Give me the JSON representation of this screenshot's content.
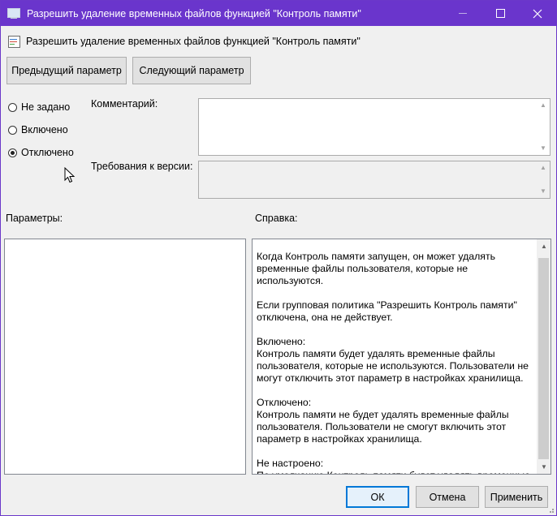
{
  "window": {
    "title": "Разрешить удаление временных файлов функцией \"Контроль памяти\"",
    "accent": "#6a35cc"
  },
  "header": {
    "policy_title": "Разрешить удаление временных файлов функцией \"Контроль памяти\""
  },
  "nav": {
    "prev_label": "Предыдущий параметр",
    "next_label": "Следующий параметр"
  },
  "state": {
    "options": [
      {
        "label": "Не задано",
        "checked": false
      },
      {
        "label": "Включено",
        "checked": false
      },
      {
        "label": "Отключено",
        "checked": true
      }
    ]
  },
  "fields": {
    "comment_label": "Комментарий:",
    "comment_value": "",
    "version_label": "Требования к версии:",
    "version_value": ""
  },
  "sections": {
    "params_label": "Параметры:",
    "help_label": "Справка:"
  },
  "help": {
    "paragraphs": [
      "Когда Контроль памяти запущен, он может удалять временные файлы пользователя, которые не используются.",
      "Если групповая политика \"Разрешить Контроль памяти\" отключена, она не действует.",
      "Включено:\nКонтроль памяти будет удалять временные файлы пользователя, которые не используются. Пользователи не могут отключить этот параметр в настройках хранилища.",
      "Отключено:\nКонтроль памяти не будет удалять временные файлы пользователя. Пользователи не смогут включить этот параметр в настройках хранилища.",
      "Не настроено:\nПо умолчанию Контроль памяти будет удалять временные"
    ]
  },
  "footer": {
    "ok_label": "ОК",
    "cancel_label": "Отмена",
    "apply_label": "Применить"
  }
}
